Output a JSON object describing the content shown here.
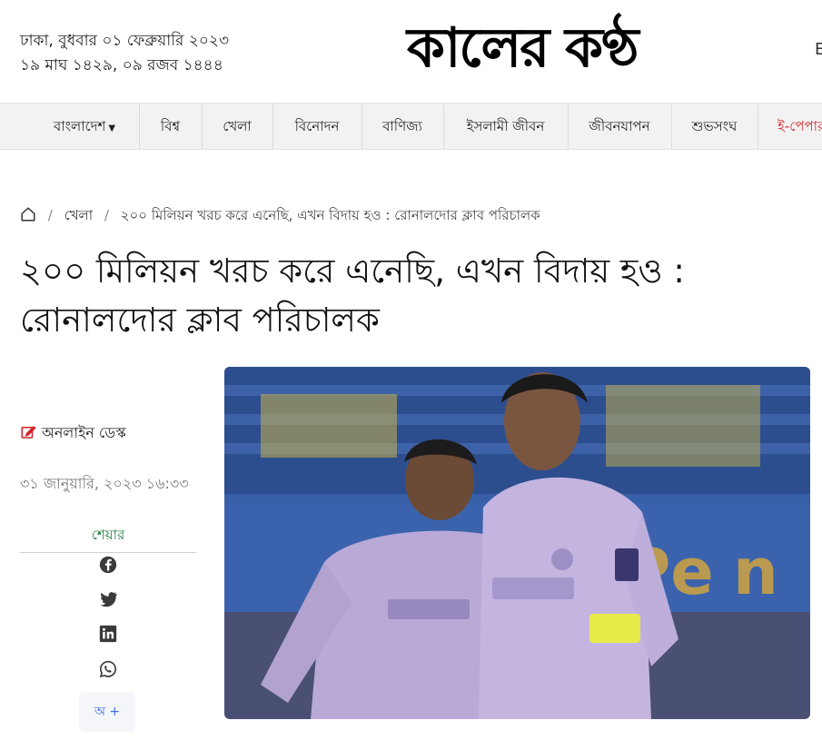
{
  "header": {
    "date_line1": "ঢাকা, বুধবার ০১ ফেব্রুয়ারি ২০২৩",
    "date_line2": "১৯ মাঘ ১৪২৯, ০৯ রজব ১৪৪৪",
    "logo": "কালের কণ্ঠ",
    "edge_letter": "E"
  },
  "nav": {
    "items": [
      {
        "label": "বাংলাদেশ"
      },
      {
        "label": "বিশ্ব"
      },
      {
        "label": "খেলা"
      },
      {
        "label": "বিনোদন"
      },
      {
        "label": "বাণিজ্য"
      },
      {
        "label": "ইসলামী জীবন"
      },
      {
        "label": "জীবনযাপন"
      },
      {
        "label": "শুভসংঘ"
      },
      {
        "label": "ই-পেপার"
      }
    ],
    "highlight_color": "#d6212a"
  },
  "breadcrumb": {
    "home_icon": "home-icon",
    "separator": "/",
    "section": "খেলা",
    "current": "২০০ মিলিয়ন খরচ করে এনেছি, এখন বিদায় হও : রোনালদোর ক্লাব পরিচালক"
  },
  "article": {
    "headline": "২০০ মিলিয়ন খরচ করে এনেছি, এখন বিদায় হও : রোনালদোর ক্লাব পরিচালক",
    "author": "অনলাইন ডেস্ক",
    "author_icon": "edit-icon",
    "published": "৩১ জানুয়ারি, ২০২৩ ১৬:৩৩"
  },
  "share": {
    "label": "শেয়ার",
    "icons": [
      "facebook-icon",
      "twitter-icon",
      "linkedin-icon",
      "whatsapp-icon"
    ]
  },
  "font_size_button": "অ +",
  "colors": {
    "accent_red": "#d6212a",
    "share_green": "#1e7a3c",
    "font_button_blue": "#3a6fd8"
  }
}
